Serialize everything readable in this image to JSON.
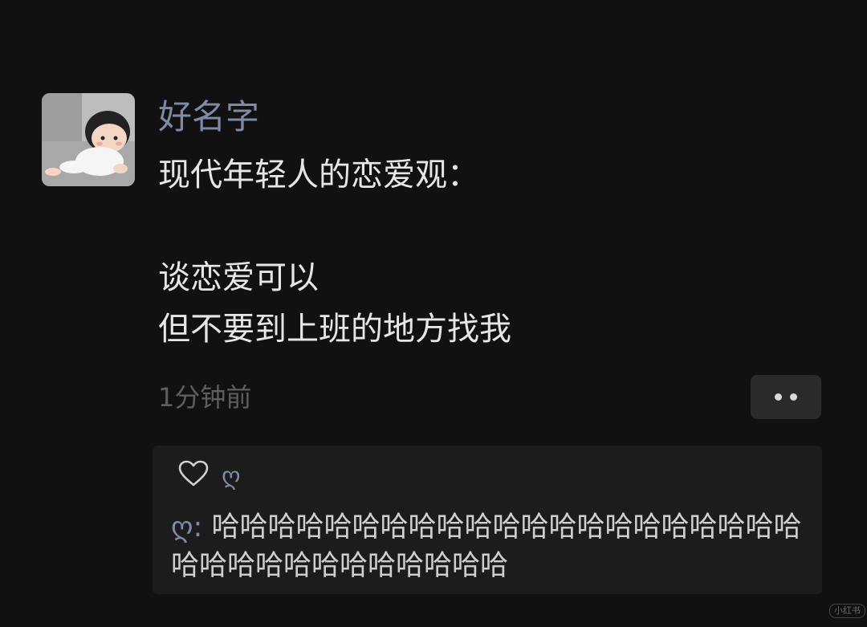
{
  "post": {
    "username": "好名字",
    "lines": [
      "现代年轻人的恋爱观：",
      "",
      "谈恋爱可以",
      "但不要到上班的地方找我"
    ],
    "timestamp": "1分钟前",
    "more_icon": "more-dots-icon",
    "avatar_icon": "baby-avatar-image"
  },
  "likes": {
    "icon": "heart-icon",
    "names": "ღ"
  },
  "comments": [
    {
      "author": "ღ",
      "separator": ": ",
      "text": "哈哈哈哈哈哈哈哈哈哈哈哈哈哈哈哈哈哈哈哈哈哈哈哈哈哈哈哈哈哈哈哈哈"
    }
  ],
  "watermark": "小红书",
  "colors": {
    "background": "#111111",
    "username": "#7f8aa6",
    "text": "#e6e6e6",
    "muted": "#5e5e5e",
    "panel": "#1c1c1c"
  }
}
